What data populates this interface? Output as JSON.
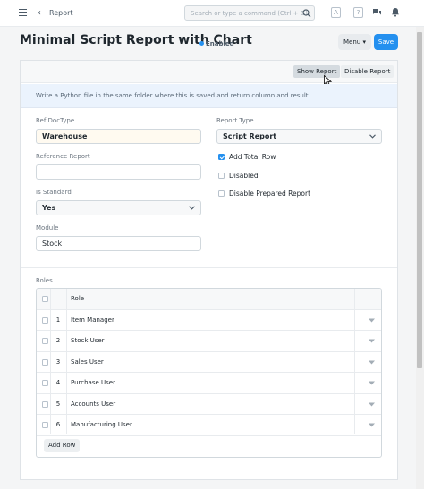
{
  "navbar": {
    "breadcrumb": "Report",
    "search_placeholder": "Search or type a command (Ctrl + G)",
    "avatar_letter": "A",
    "help_letter": "?"
  },
  "page": {
    "title": "Minimal Script Report with Chart",
    "status": "Enabled",
    "menu_label": "Menu",
    "save_label": "Save"
  },
  "toolbar": {
    "show_report": "Show Report",
    "disable_report": "Disable Report"
  },
  "help_text": "Write a Python file in the same folder where this is saved and return column and result.",
  "form": {
    "ref_doctype": {
      "label": "Ref DocType",
      "value": "Warehouse"
    },
    "reference_report": {
      "label": "Reference Report",
      "value": ""
    },
    "is_standard": {
      "label": "Is Standard",
      "value": "Yes"
    },
    "module": {
      "label": "Module",
      "value": "Stock"
    },
    "report_type": {
      "label": "Report Type",
      "value": "Script Report"
    },
    "checkboxes": [
      {
        "label": "Add Total Row",
        "checked": true
      },
      {
        "label": "Disabled",
        "checked": false
      },
      {
        "label": "Disable Prepared Report",
        "checked": false
      }
    ]
  },
  "roles": {
    "label": "Roles",
    "column_header": "Role",
    "rows": [
      {
        "idx": "1",
        "role": "Item Manager"
      },
      {
        "idx": "2",
        "role": "Stock User"
      },
      {
        "idx": "3",
        "role": "Sales User"
      },
      {
        "idx": "4",
        "role": "Purchase User"
      },
      {
        "idx": "5",
        "role": "Accounts User"
      },
      {
        "idx": "6",
        "role": "Manufacturing User"
      }
    ],
    "add_row_label": "Add Row"
  },
  "colors": {
    "primary": "#2490ef",
    "ref_doctype_bg": "#fffaf0",
    "help_bg": "#ebf3fd"
  }
}
